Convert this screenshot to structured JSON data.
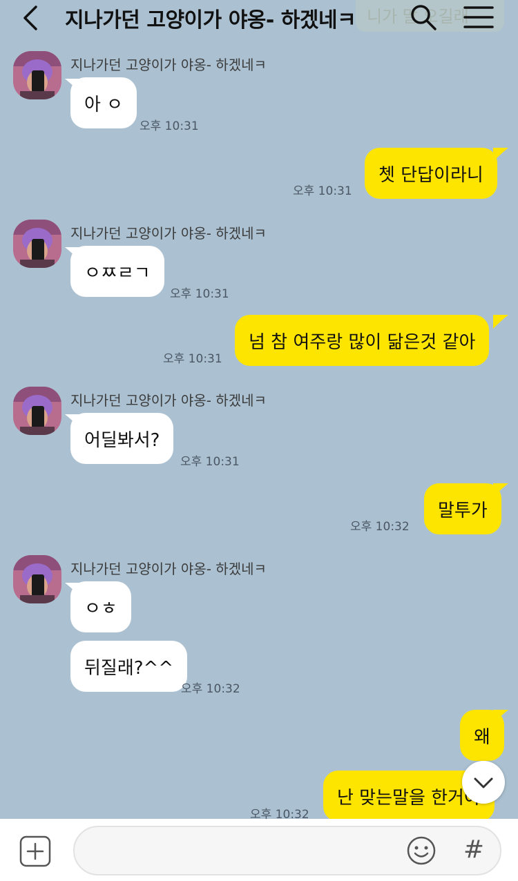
{
  "header": {
    "title": "지나가던 고양이가 야옹- 하겠네ㅋ",
    "ghost_text": "니가 말 오길래"
  },
  "messages": {
    "m1": {
      "sender": "지나가던 고양이가 야옹- 하겠네ㅋ",
      "text": "아 ㅇ",
      "time": "오후 10:31"
    },
    "m2": {
      "text": "쳇 단답이라니",
      "time": "오후 10:31"
    },
    "m3": {
      "sender": "지나가던 고양이가 야옹- 하겠네ㅋ",
      "text": "ㅇㅉㄹㄱ",
      "time": "오후 10:31"
    },
    "m4": {
      "text": "넘 참 여주랑 많이 닮은것 같아",
      "time": "오후 10:31"
    },
    "m5": {
      "sender": "지나가던 고양이가 야옹- 하겠네ㅋ",
      "text": "어딜봐서?",
      "time": "오후 10:31"
    },
    "m6": {
      "text": "말투가",
      "time": "오후 10:32"
    },
    "m7": {
      "sender": "지나가던 고양이가 야옹- 하겠네ㅋ",
      "text": "ㅇㅎ"
    },
    "m8": {
      "text": "뒤질래?^^",
      "time": "오후 10:32"
    },
    "m9": {
      "text": "왜"
    },
    "m10": {
      "text": "난 맞는말을 한거야",
      "time": "오후 10:32"
    }
  },
  "composer": {
    "placeholder": "",
    "hash_label": "#"
  },
  "colors": {
    "background": "#abc1d1",
    "outgoing_bubble": "#fee500",
    "incoming_bubble": "#ffffff"
  }
}
